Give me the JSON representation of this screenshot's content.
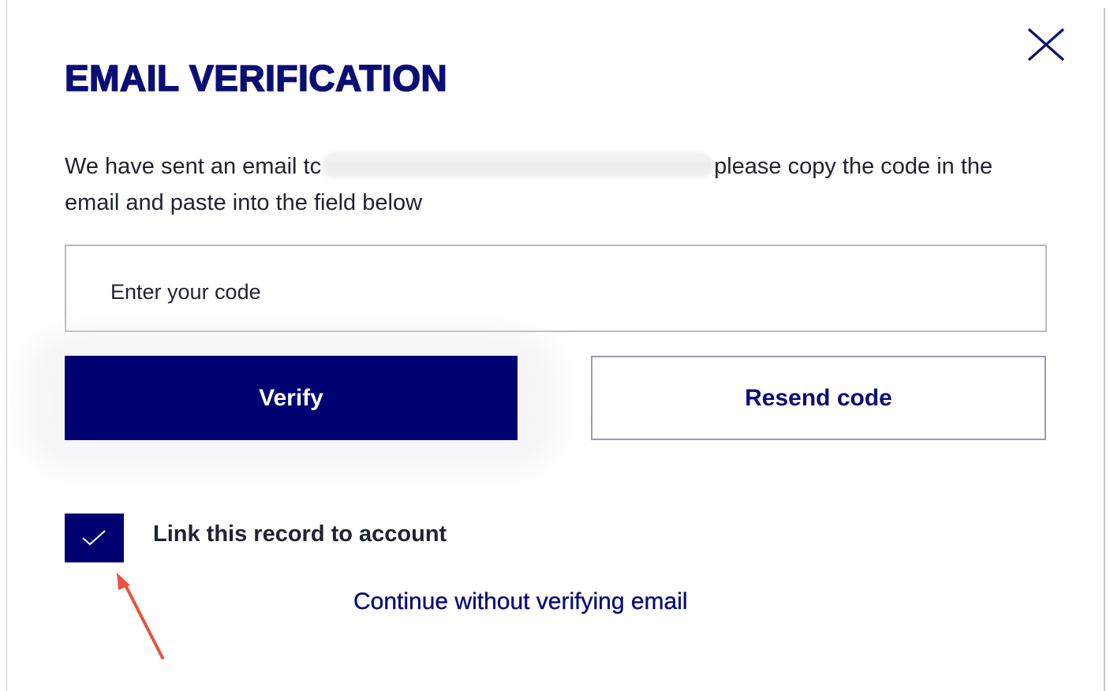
{
  "dialog": {
    "title": "EMAIL VERIFICATION",
    "message_before": "We have sent an email tc",
    "message_after": "please copy the code in the email and paste into the field below",
    "close_icon": "close-icon"
  },
  "code_input": {
    "value": "",
    "placeholder": "Enter your code"
  },
  "buttons": {
    "verify_label": "Verify",
    "resend_label": "Resend code"
  },
  "link_record": {
    "checked": true,
    "label": "Link this record to account",
    "check_icon": "checkmark-icon"
  },
  "continue_link": {
    "label": "Continue without verifying email"
  },
  "annotation": {
    "icon": "arrow-annotation-icon",
    "color": "#e8533f"
  },
  "colors": {
    "primary": "#000071",
    "title": "#0b0f73",
    "text": "#1f2330",
    "border": "#b9b9c2"
  }
}
